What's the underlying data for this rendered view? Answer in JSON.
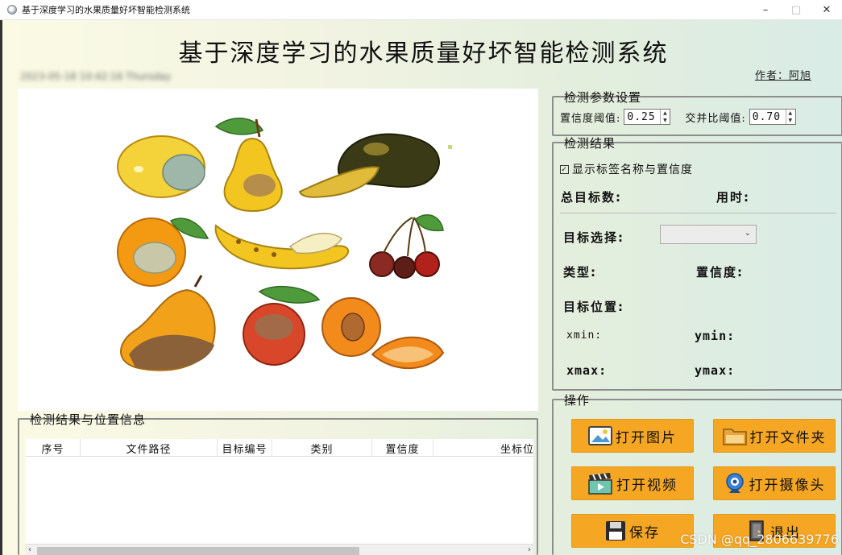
{
  "window": {
    "title": "基于深度学习的水果质量好坏智能检测系统",
    "minimize": "–",
    "maximize": "□",
    "close": "✕"
  },
  "header": {
    "title": "基于深度学习的水果质量好坏智能检测系统",
    "author": "作者：阿旭",
    "datetime_blurred": "2023-05-18 10:42:16 Thursday"
  },
  "params": {
    "title": "检测参数设置",
    "conf_label": "置信度阈值:",
    "conf_value": "0.25",
    "iou_label": "交并比阈值:",
    "iou_value": "0.70"
  },
  "results": {
    "title": "检测结果",
    "show_label_checkbox": "显示标签名称与置信度",
    "total_targets_label": "总目标数:",
    "time_label": "用时:",
    "target_select_label": "目标选择:",
    "type_label": "类型:",
    "confidence_label": "置信度:",
    "position_label": "目标位置:",
    "xmin_label": "xmin:",
    "ymin_label": "ymin:",
    "xmax_label": "xmax:",
    "ymax_label": "ymax:"
  },
  "operations": {
    "title": "操作",
    "open_image": "打开图片",
    "open_folder": "打开文件夹",
    "open_video": "打开视频",
    "open_camera": "打开摄像头",
    "save": "保存",
    "exit": "退出"
  },
  "table": {
    "title": "检测结果与位置信息",
    "columns": [
      "序号",
      "文件路径",
      "目标编号",
      "类别",
      "置信度",
      "坐标位置"
    ]
  },
  "watermark": "CSDN @qq_2806639776",
  "colors": {
    "button_orange": "#f5a623",
    "groupbox_border": "#8d8d8d"
  }
}
